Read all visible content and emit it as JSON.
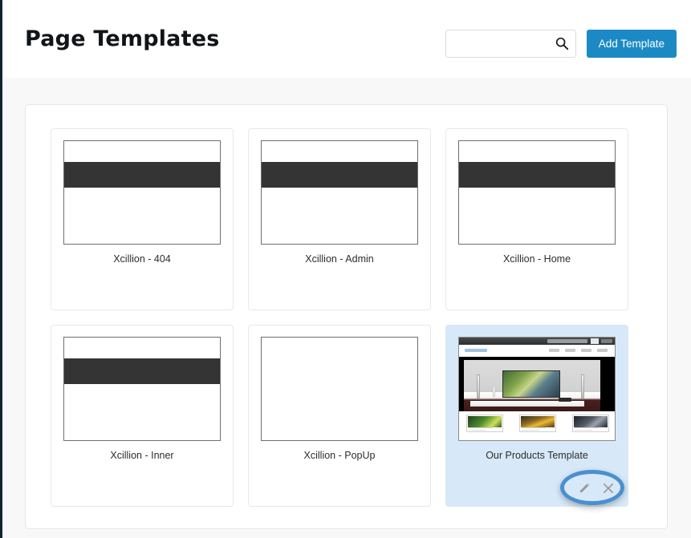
{
  "header": {
    "title": "Page Templates",
    "search": {
      "value": "",
      "placeholder": "",
      "icon": "search-icon"
    },
    "add_button_label": "Add Template"
  },
  "colors": {
    "accent_blue": "#1b8ac4",
    "highlight_ring": "#4a90d0",
    "selected_card_bg": "#d7e9f8",
    "sidebar_edge": "#10232e",
    "page_bg": "#f8f8f9",
    "wireframe_band": "#343434"
  },
  "templates": [
    {
      "label": "Xcillion - 404",
      "preview": "wireframe",
      "selected": false
    },
    {
      "label": "Xcillion - Admin",
      "preview": "wireframe",
      "selected": false
    },
    {
      "label": "Xcillion - Home",
      "preview": "wireframe",
      "selected": false
    },
    {
      "label": "Xcillion - Inner",
      "preview": "wireframe",
      "selected": false
    },
    {
      "label": "Xcillion - PopUp",
      "preview": "blank",
      "selected": false
    },
    {
      "label": "Our Products Template",
      "preview": "site",
      "selected": true
    }
  ],
  "card_actions": {
    "edit_icon": "pencil-icon",
    "delete_icon": "close-x-icon"
  }
}
